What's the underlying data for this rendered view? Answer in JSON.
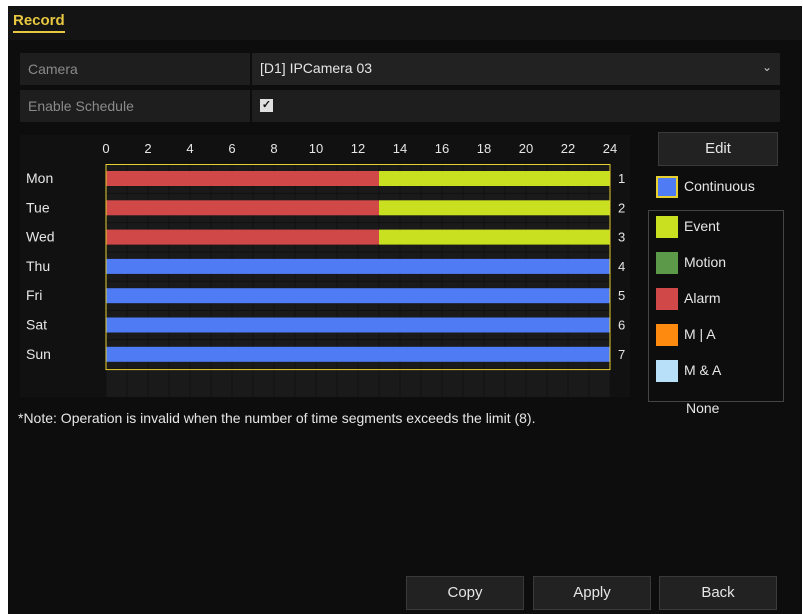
{
  "window": {
    "title": "Record"
  },
  "camera": {
    "label": "Camera",
    "value": "[D1] IPCamera 03"
  },
  "enable_schedule": {
    "label": "Enable Schedule",
    "checked": true
  },
  "schedule": {
    "hour_ticks": [
      "0",
      "2",
      "4",
      "6",
      "8",
      "10",
      "12",
      "14",
      "16",
      "18",
      "20",
      "22",
      "24"
    ],
    "days": [
      {
        "name": "Mon",
        "index": "1",
        "segments": [
          {
            "start": 0,
            "end": 13,
            "type": "alarm"
          },
          {
            "start": 13,
            "end": 24,
            "type": "event"
          }
        ]
      },
      {
        "name": "Tue",
        "index": "2",
        "segments": [
          {
            "start": 0,
            "end": 13,
            "type": "alarm"
          },
          {
            "start": 13,
            "end": 24,
            "type": "event"
          }
        ]
      },
      {
        "name": "Wed",
        "index": "3",
        "segments": [
          {
            "start": 0,
            "end": 13,
            "type": "alarm"
          },
          {
            "start": 13,
            "end": 24,
            "type": "event"
          }
        ]
      },
      {
        "name": "Thu",
        "index": "4",
        "segments": [
          {
            "start": 0,
            "end": 24,
            "type": "continuous"
          }
        ]
      },
      {
        "name": "Fri",
        "index": "5",
        "segments": [
          {
            "start": 0,
            "end": 24,
            "type": "continuous"
          }
        ]
      },
      {
        "name": "Sat",
        "index": "6",
        "segments": [
          {
            "start": 0,
            "end": 24,
            "type": "continuous"
          }
        ]
      },
      {
        "name": "Sun",
        "index": "7",
        "segments": [
          {
            "start": 0,
            "end": 24,
            "type": "continuous"
          }
        ]
      }
    ]
  },
  "edit_button": "Edit",
  "legend": [
    {
      "key": "continuous",
      "label": "Continuous",
      "color": "#4f7cf5"
    },
    {
      "key": "event",
      "label": "Event",
      "color": "#c8e020"
    },
    {
      "key": "motion",
      "label": "Motion",
      "color": "#5c9a4a"
    },
    {
      "key": "alarm",
      "label": "Alarm",
      "color": "#d04848"
    },
    {
      "key": "ma_or",
      "label": "M | A",
      "color": "#ff8a10"
    },
    {
      "key": "ma_and",
      "label": "M & A",
      "color": "#b8e0f8"
    },
    {
      "key": "none",
      "label": "None",
      "color": ""
    }
  ],
  "note": "*Note: Operation is invalid when the number of time segments exceeds the limit (8).",
  "buttons": {
    "copy": "Copy",
    "apply": "Apply",
    "back": "Back"
  }
}
